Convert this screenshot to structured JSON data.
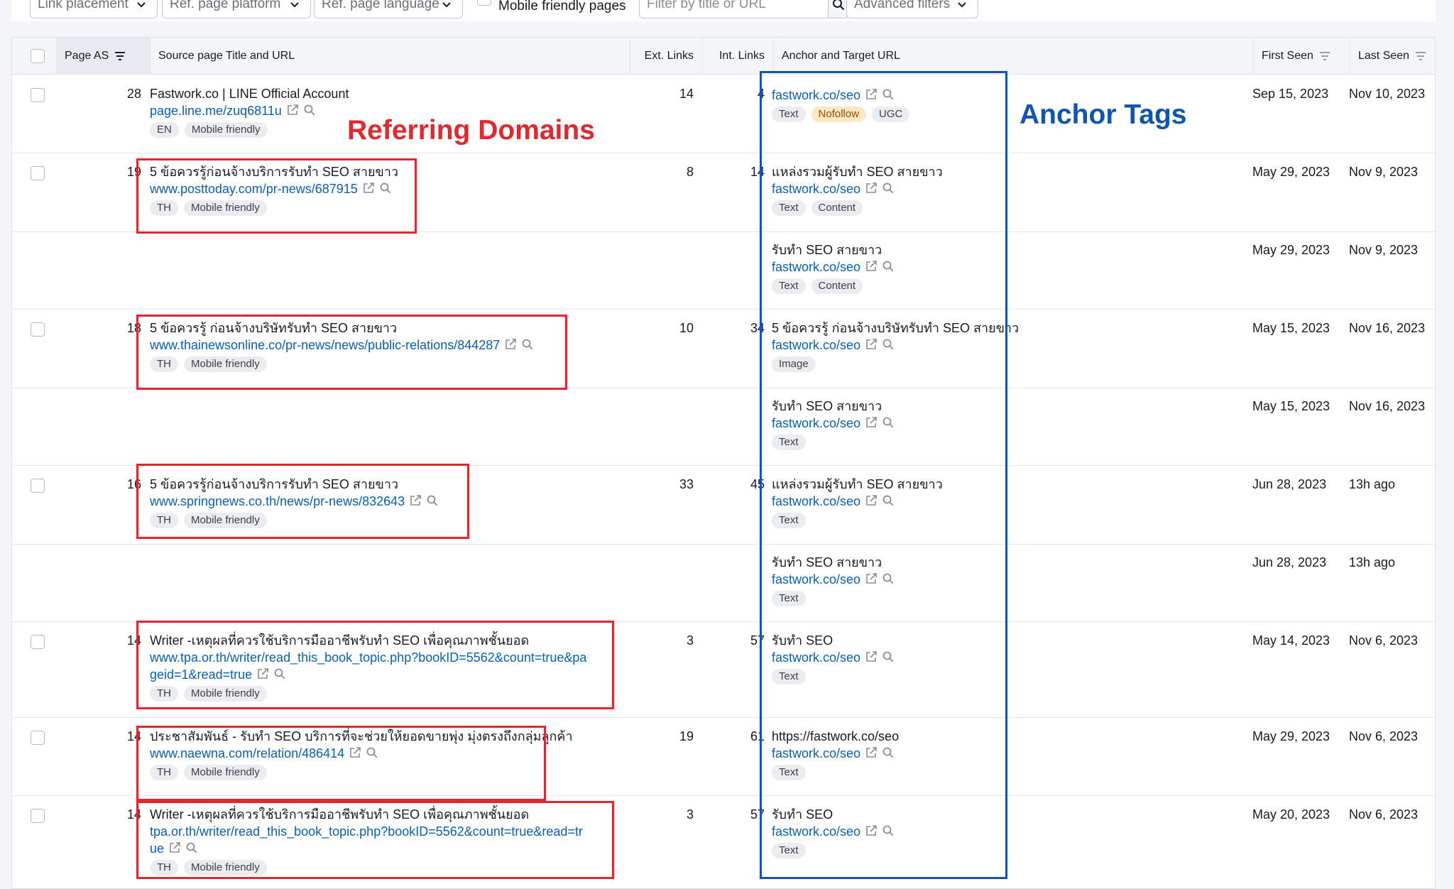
{
  "filters": {
    "link_placement": "Link placement",
    "ref_page_platform": "Ref. page platform",
    "ref_page_language": "Ref. page language",
    "mobile_friendly": "Mobile friendly pages",
    "search_placeholder": "Filter by title or URL",
    "advanced": "Advanced filters"
  },
  "columns": {
    "page_as": "Page AS",
    "source": "Source page Title and URL",
    "ext_links": "Ext. Links",
    "int_links": "Int. Links",
    "anchor": "Anchor and Target URL",
    "first_seen": "First Seen",
    "last_seen": "Last Seen"
  },
  "annotations": {
    "referring_domains": "Referring Domains",
    "anchor_tags": "Anchor Tags"
  },
  "rows": [
    {
      "as": "28",
      "title": "Fastwork.co | LINE Official Account",
      "url": [
        "page.line.me/zuq6811u"
      ],
      "tags": [
        "EN",
        "Mobile friendly"
      ],
      "ext": "14",
      "int": "4",
      "anchors": [
        {
          "text": "",
          "target": "fastwork.co/seo",
          "tags": [
            "Text",
            "Nofollow",
            "UGC"
          ],
          "first": "Sep 15, 2023",
          "last": "Nov 10, 2023"
        }
      ]
    },
    {
      "as": "19",
      "title": "5 ข้อควรรู้ก่อนจ้างบริการรับทำ SEO สายขาว",
      "url": [
        "www.posttoday.com/pr-news/687915"
      ],
      "tags": [
        "TH",
        "Mobile friendly"
      ],
      "ext": "8",
      "int": "14",
      "anchors": [
        {
          "text": "แหล่งรวมผู้รับทำ SEO สายขาว",
          "target": "fastwork.co/seo",
          "tags": [
            "Text",
            "Content"
          ],
          "first": "May 29, 2023",
          "last": "Nov 9, 2023"
        },
        {
          "text": "รับทำ SEO สายขาว",
          "target": "fastwork.co/seo",
          "tags": [
            "Text",
            "Content"
          ],
          "first": "May 29, 2023",
          "last": "Nov 9, 2023"
        }
      ]
    },
    {
      "as": "18",
      "title": "5 ข้อควรรู้ ก่อนจ้างบริษัทรับทำ SEO สายขาว",
      "url": [
        "www.thainewsonline.co/pr-news/news/public-relations/844287"
      ],
      "tags": [
        "TH",
        "Mobile friendly"
      ],
      "ext": "10",
      "int": "34",
      "anchors": [
        {
          "text": "5 ข้อควรรู้ ก่อนจ้างบริษัทรับทำ SEO สายขาว",
          "target": "fastwork.co/seo",
          "tags": [
            "Image"
          ],
          "first": "May 15, 2023",
          "last": "Nov 16, 2023"
        },
        {
          "text": "รับทำ SEO สายขาว",
          "target": "fastwork.co/seo",
          "tags": [
            "Text"
          ],
          "first": "May 15, 2023",
          "last": "Nov 16, 2023"
        }
      ]
    },
    {
      "as": "16",
      "title": "5 ข้อควรรู้ก่อนจ้างบริการรับทำ SEO สายขาว",
      "url": [
        "www.springnews.co.th/news/pr-news/832643"
      ],
      "tags": [
        "TH",
        "Mobile friendly"
      ],
      "ext": "33",
      "int": "45",
      "anchors": [
        {
          "text": "แหล่งรวมผู้รับทำ SEO สายขาว",
          "target": "fastwork.co/seo",
          "tags": [
            "Text"
          ],
          "first": "Jun 28, 2023",
          "last": "13h ago"
        },
        {
          "text": "รับทำ SEO สายขาว",
          "target": "fastwork.co/seo",
          "tags": [
            "Text"
          ],
          "first": "Jun 28, 2023",
          "last": "13h ago"
        }
      ]
    },
    {
      "as": "14",
      "title": "Writer -เหตุผลที่ควรใช้บริการมืออาชีพรับทำ SEO เพื่อคุณภาพชั้นยอด",
      "url": [
        "www.tpa.or.th/writer/read_this_book_topic.php?bookID=5562&count=true&pa",
        "geid=1&read=true"
      ],
      "tags": [
        "TH",
        "Mobile friendly"
      ],
      "ext": "3",
      "int": "57",
      "anchors": [
        {
          "text": "รับทำ SEO",
          "target": "fastwork.co/seo",
          "tags": [
            "Text"
          ],
          "first": "May 14, 2023",
          "last": "Nov 6, 2023"
        }
      ]
    },
    {
      "as": "14",
      "title": "ประชาสัมพันธ์ - รับทำ SEO บริการที่จะช่วยให้ยอดขายพุ่ง มุ่งตรงถึงกลุ่มลูกค้า",
      "url": [
        "www.naewna.com/relation/486414"
      ],
      "tags": [
        "TH",
        "Mobile friendly"
      ],
      "ext": "19",
      "int": "61",
      "anchors": [
        {
          "text": "https://fastwork.co/seo",
          "target": "fastwork.co/seo",
          "tags": [
            "Text"
          ],
          "first": "May 29, 2023",
          "last": "Nov 6, 2023"
        }
      ]
    },
    {
      "as": "14",
      "title": "Writer -เหตุผลที่ควรใช้บริการมืออาชีพรับทำ SEO เพื่อคุณภาพชั้นยอด",
      "url": [
        "tpa.or.th/writer/read_this_book_topic.php?bookID=5562&count=true&read=tr",
        "ue"
      ],
      "tags": [
        "TH",
        "Mobile friendly"
      ],
      "ext": "3",
      "int": "57",
      "anchors": [
        {
          "text": "รับทำ SEO",
          "target": "fastwork.co/seo",
          "tags": [
            "Text"
          ],
          "first": "May 20, 2023",
          "last": "Nov 6, 2023"
        }
      ]
    }
  ]
}
